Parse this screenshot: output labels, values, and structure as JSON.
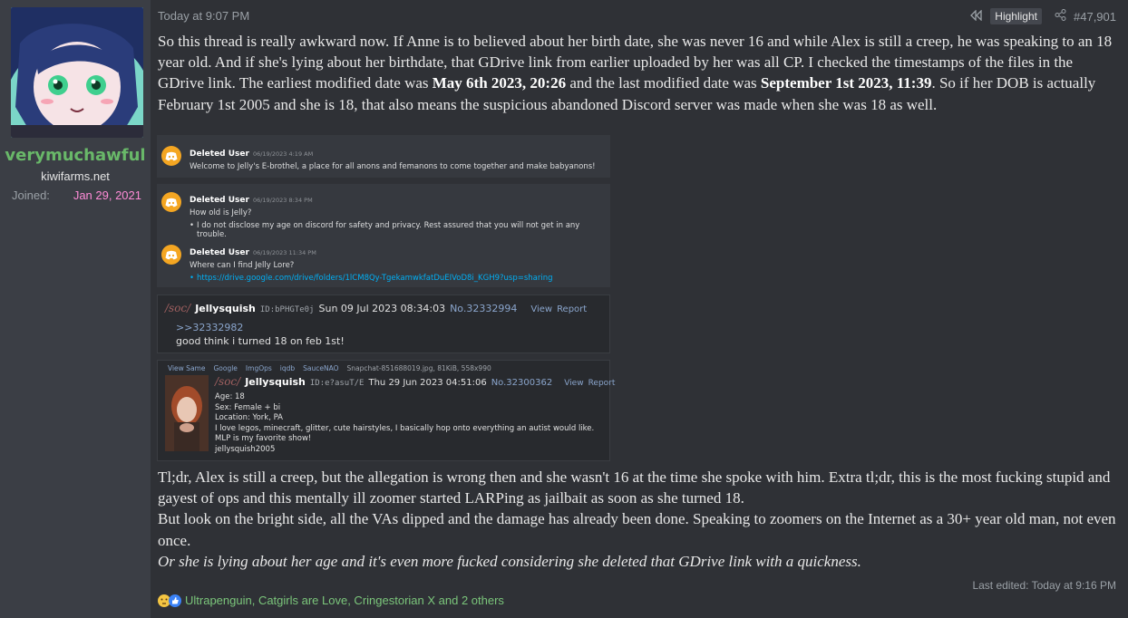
{
  "user": {
    "name": "verymuchawful",
    "title": "kiwifarms.net",
    "joined_label": "Joined:",
    "joined_value": "Jan 29, 2021"
  },
  "header": {
    "timestamp": "Today at 9:07 PM",
    "highlight_label": "Highlight",
    "post_number": "#47,901"
  },
  "body": {
    "p1_a": "So this thread is really awkward now. If Anne is to believed about her birth date, she was never 16 and while Alex is still a creep, he was speaking to an 18 year old. And if she's lying about her birthdate, that GDrive link from earlier uploaded by her was all CP. I checked the timestamps of the files in the GDrive link. The earliest modified date was ",
    "p1_b1": "May 6th 2023, 20:26",
    "p1_c": " and the last modified date was ",
    "p1_b2": "September 1st 2023, 11:39",
    "p1_d": ". So if her DOB is actually February 1st 2005 and she is 18, that also means the suspicious abandoned Discord server was made when she was 18 as well.",
    "p2": "Tl;dr, Alex is still a creep, but the allegation is wrong then and she wasn't 16 at the time she spoke with him. Extra tl;dr, this is the most fucking stupid and gayest of ops and this mentally ill zoomer started LARPing as jailbait as soon as she turned 18.",
    "p3": "But look on the bright side, all the VAs dipped and the damage has already been done. Speaking to zoomers on the Internet as a 30+ year old man, not even once.",
    "p4": "Or she is lying about her age and it's even more fucked considering she deleted that GDrive link with a quickness."
  },
  "discord": [
    {
      "name": "Deleted User",
      "time": "06/19/2023 4:19 AM",
      "text": "Welcome to Jelly's E-brothel, a place for all anons and femanons to come together and make babyanons!"
    },
    {
      "name": "Deleted User",
      "time": "06/19/2023 8:34 PM",
      "text": "How old is Jelly?",
      "bullet": "I do not disclose my age on discord for safety and privacy. Rest assured that you will not get in any trouble."
    },
    {
      "name": "Deleted User",
      "time": "06/19/2023 11:34 PM",
      "text": "Where can I find Jelly Lore?",
      "bullet": "https://drive.google.com/drive/folders/1lCM8Qy-TgekamwkfatDuEIVoD8i_KGH9?usp=sharing"
    }
  ],
  "chan1": {
    "board": "/soc/",
    "name": "Jellysquish",
    "id": "ID:bPHGTe0j",
    "date": "Sun 09 Jul 2023 08:34:03",
    "no": "No.32332994",
    "view": "View",
    "report": "Report",
    "quote": ">>32332982",
    "text": "good think i turned 18 on feb 1st!"
  },
  "chan2": {
    "links": [
      "View Same",
      "Google",
      "ImgOps",
      "iqdb",
      "SauceNAO"
    ],
    "file": "Snapchat-851688019.jpg, 81KiB, 558x990",
    "board": "/soc/",
    "name": "Jellysquish",
    "id": "ID:e?asuT/E",
    "date": "Thu 29 Jun 2023 04:51:06",
    "no": "No.32300362",
    "view": "View",
    "report": "Report",
    "lines": [
      "Age: 18",
      "Sex: Female + bi",
      "Location: York, PA",
      "I love legos, minecraft, glitter, cute hairstyles, I basically hop onto everything an autist would like. MLP is my favorite show!",
      "jellysquish2005"
    ]
  },
  "footer": {
    "edited": "Last edited: Today at 9:16 PM",
    "reactions": "Ultrapenguin, Catgirls are Love, Cringestorian X and 2 others"
  }
}
